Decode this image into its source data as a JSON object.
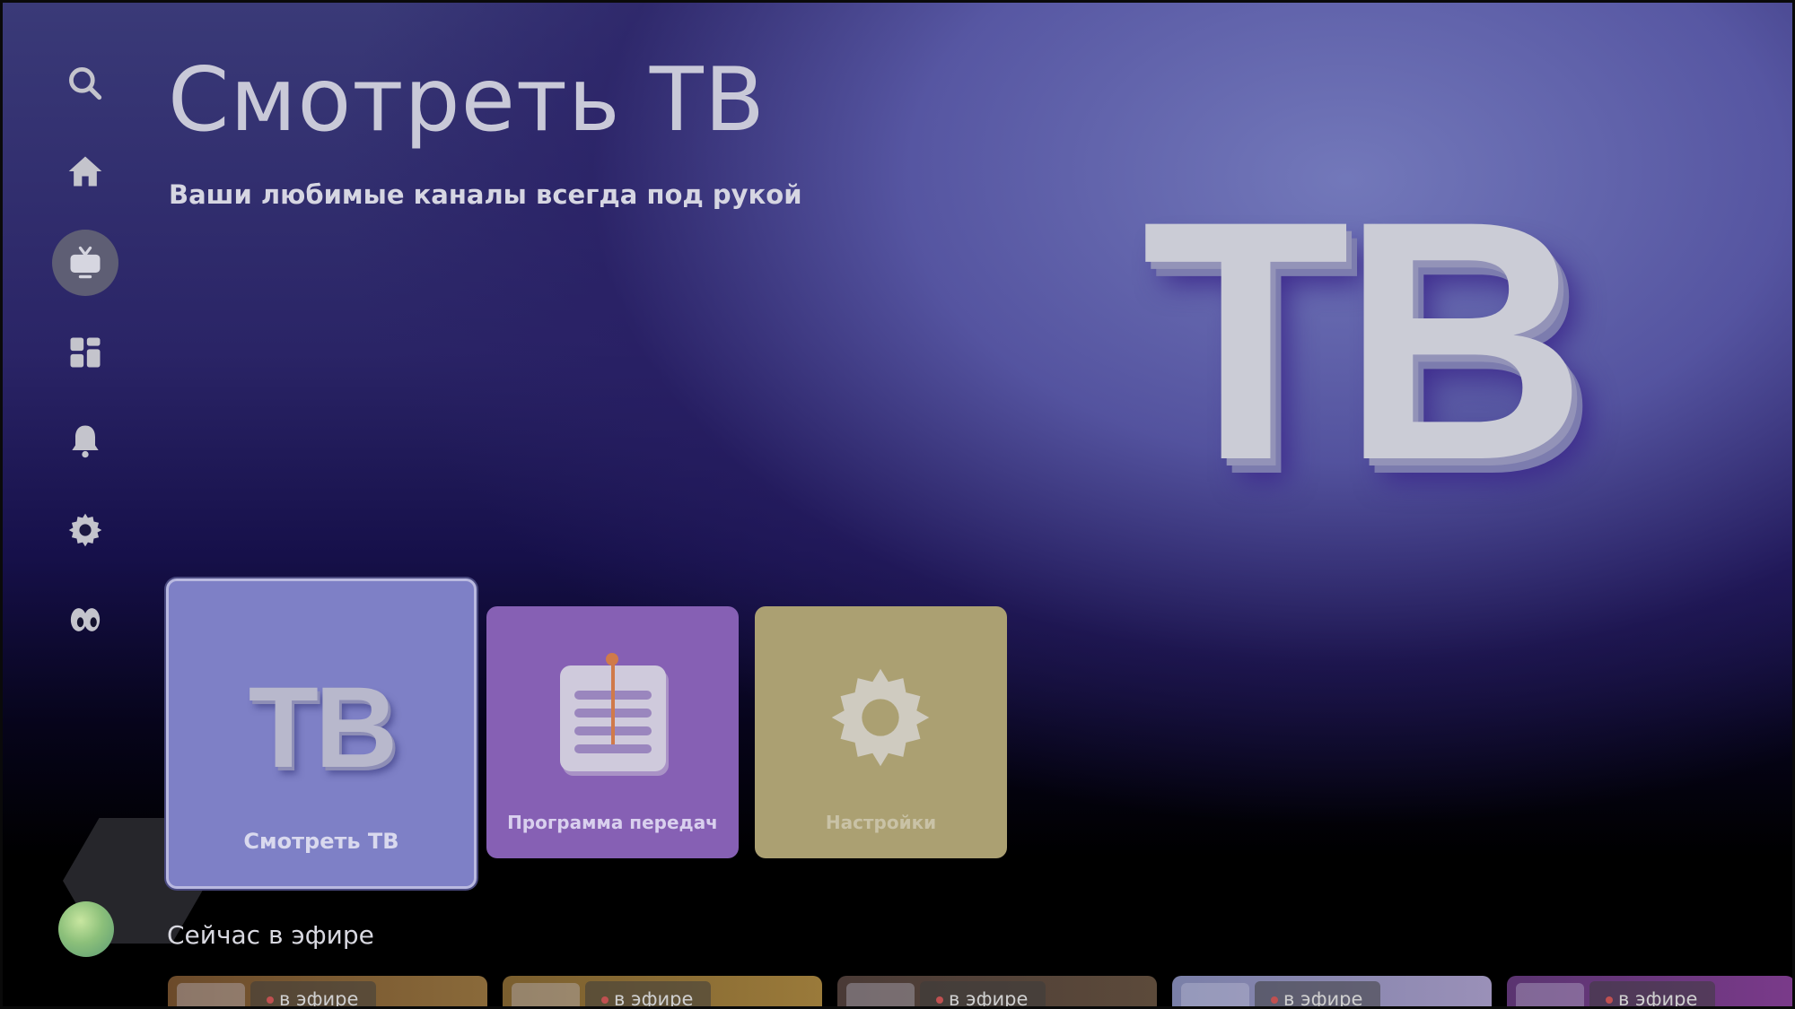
{
  "header": {
    "title": "Смотреть ТВ",
    "subtitle": "Ваши любимые каналы всегда под рукой"
  },
  "hero": {
    "text": "ТВ"
  },
  "sidebar": {
    "items": [
      {
        "icon": "search-icon"
      },
      {
        "icon": "home-icon"
      },
      {
        "icon": "tv-icon",
        "active": true
      },
      {
        "icon": "apps-icon"
      },
      {
        "icon": "bell-icon"
      },
      {
        "icon": "gear-icon"
      },
      {
        "icon": "eyes-icon"
      }
    ]
  },
  "tiles": [
    {
      "label": "Смотреть ТВ",
      "glyph": "ТВ",
      "focused": true,
      "color": "#7e80c6"
    },
    {
      "label": "Программа передач",
      "icon": "guide-icon",
      "color": "#8660b4"
    },
    {
      "label": "Настройки",
      "icon": "gear-icon",
      "color": "#aba072"
    }
  ],
  "now_on_air": {
    "title": "Сейчас в эфире",
    "cards": [
      {
        "badge": "в эфире",
        "color": "#6b4a2a"
      },
      {
        "badge": "в эфире",
        "color": "#7a5e2e"
      },
      {
        "badge": "в эфире",
        "color": "#4a3a36"
      },
      {
        "badge": "в эфире",
        "color": "#7a7fa8"
      },
      {
        "badge": "в эфире",
        "color": "#5a3470"
      }
    ]
  }
}
